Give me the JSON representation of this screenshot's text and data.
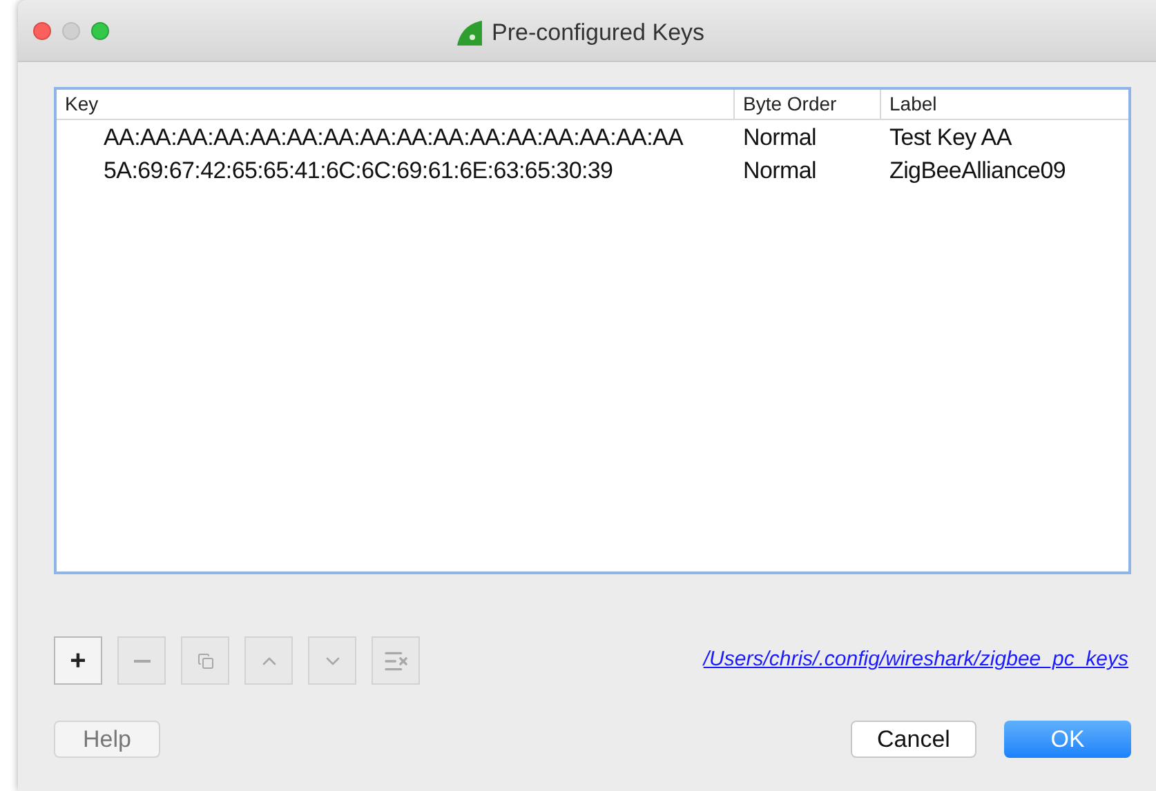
{
  "window": {
    "title": "Pre-configured Keys"
  },
  "table": {
    "columns": [
      "Key",
      "Byte Order",
      "Label"
    ],
    "rows": [
      {
        "cells": [
          "AA:AA:AA:AA:AA:AA:AA:AA:AA:AA:AA:AA:AA:AA:AA:AA",
          "Normal",
          "Test Key AA"
        ]
      },
      {
        "cells": [
          "5A:69:67:42:65:65:41:6C:6C:69:61:6E:63:65:30:39",
          "Normal",
          "ZigBeeAlliance09"
        ]
      }
    ]
  },
  "toolbar": [
    {
      "kind": "add",
      "label": "+",
      "disabled": false
    },
    {
      "kind": "remove",
      "disabled": true
    },
    {
      "kind": "copy",
      "disabled": true
    },
    {
      "kind": "up",
      "disabled": true
    },
    {
      "kind": "down",
      "disabled": true
    },
    {
      "kind": "clear",
      "disabled": true
    }
  ],
  "file_link": "/Users/chris/.config/wireshark/zigbee_pc_keys",
  "buttons": {
    "help": "Help",
    "cancel": "Cancel",
    "ok": "OK"
  }
}
